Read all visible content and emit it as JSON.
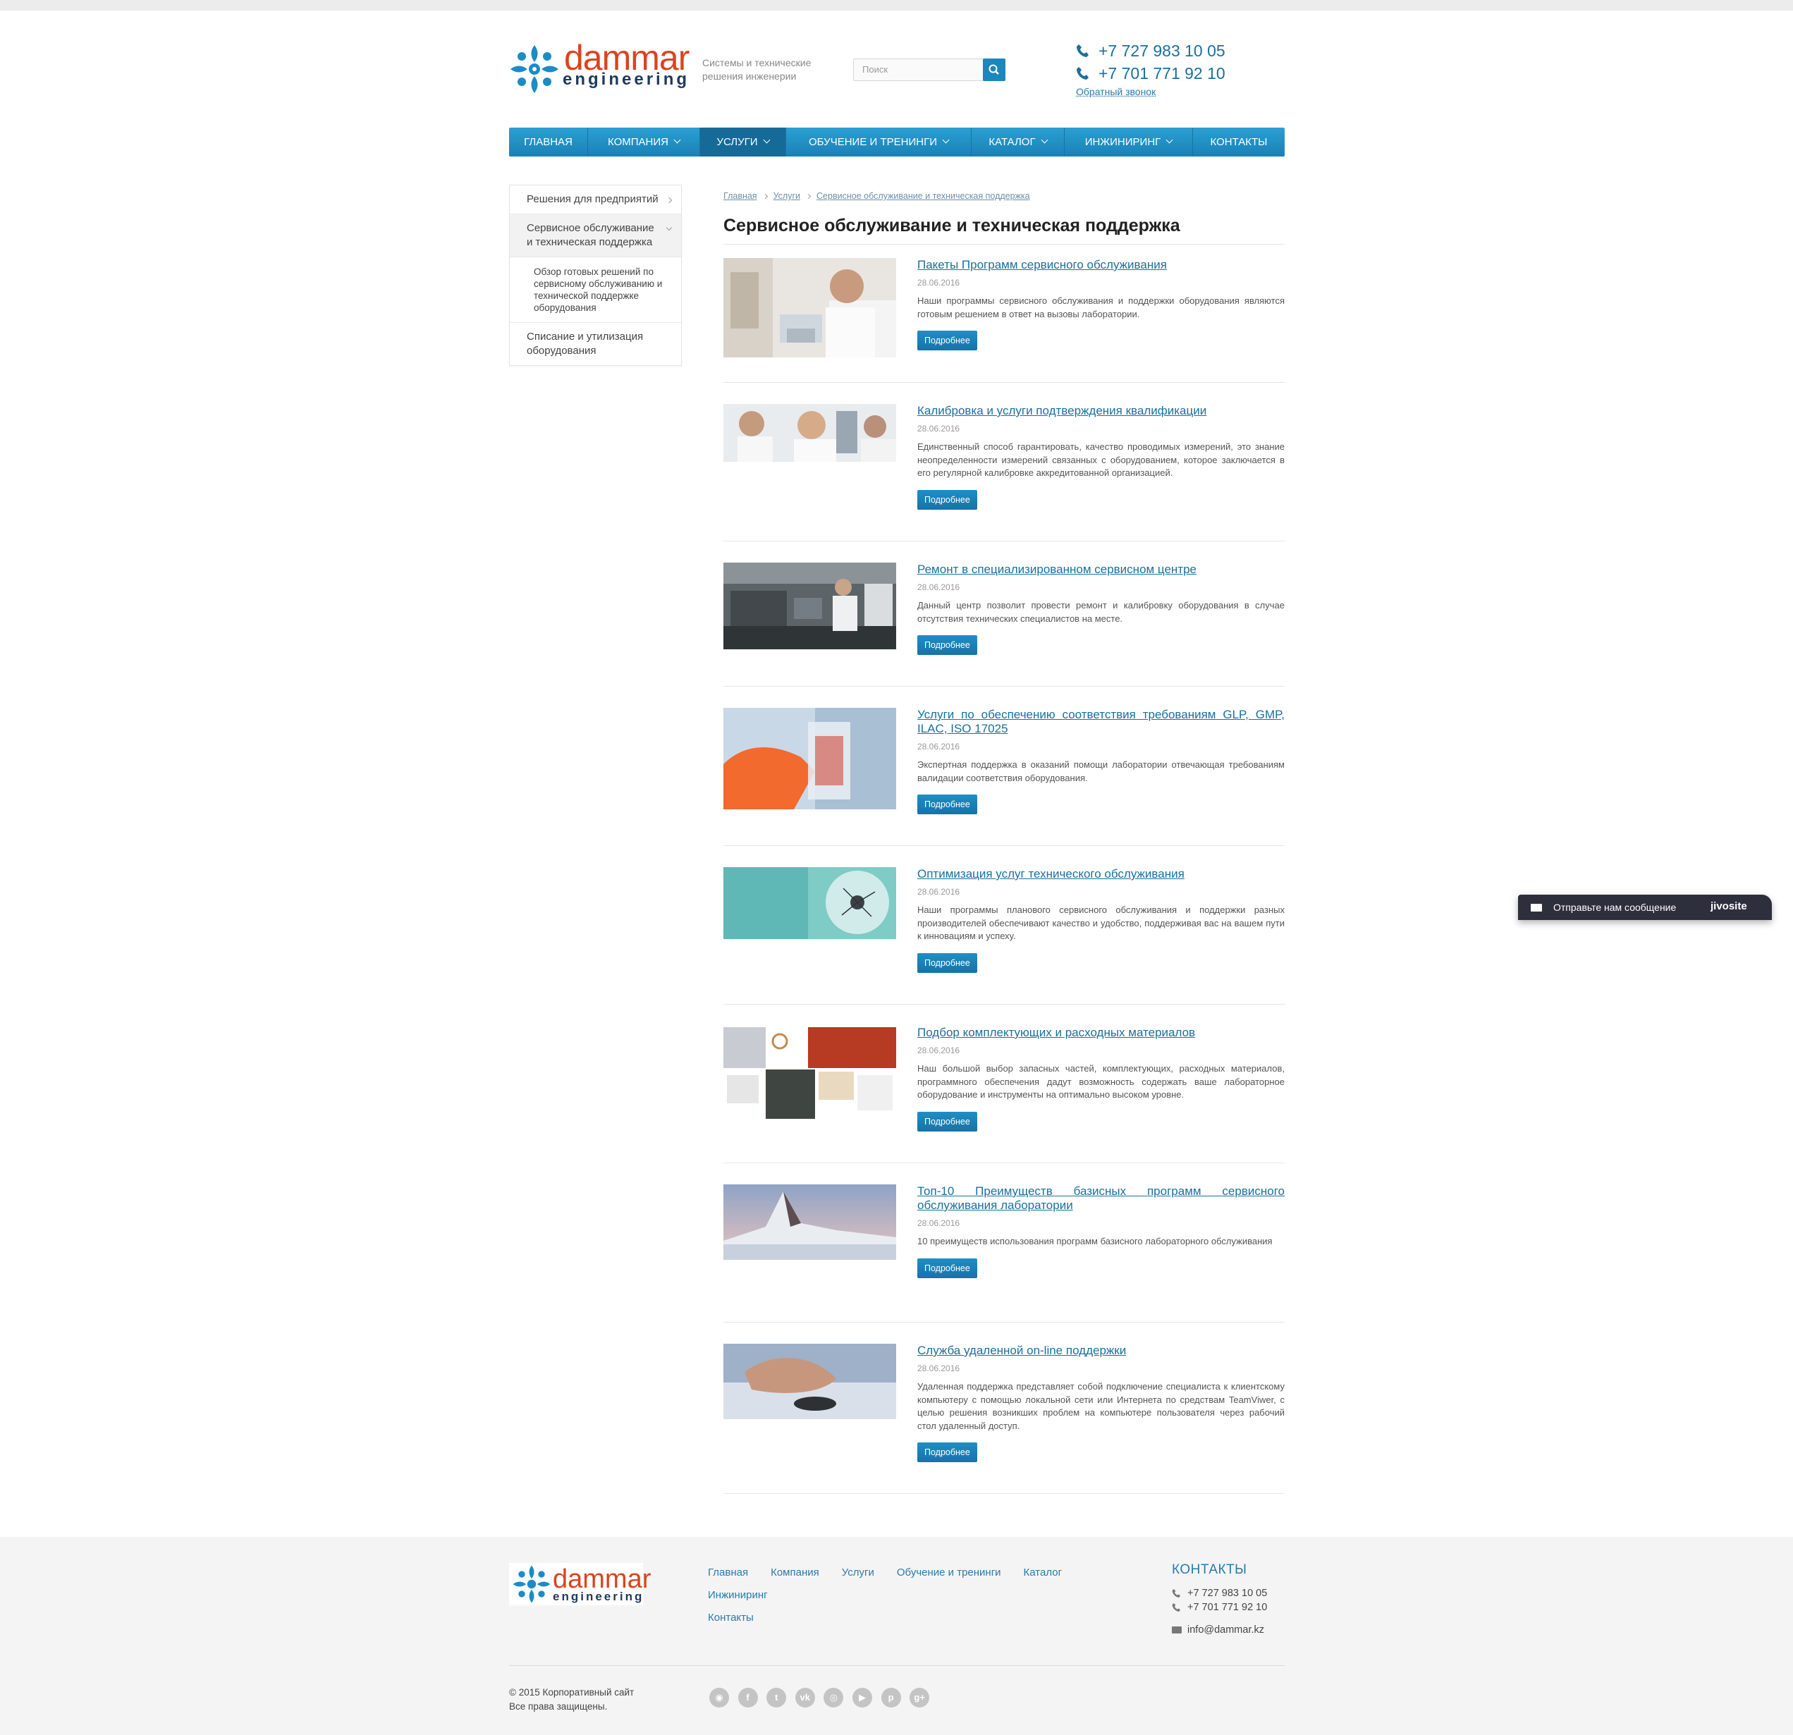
{
  "header": {
    "logo_word": "dammar",
    "logo_sub": "engineering",
    "slogan": "Системы и технические решения инженерии",
    "search_placeholder": "Поиск",
    "phone1": "+7 727 983 10 05",
    "phone2": "+7 701 771 92 10",
    "callback": "Обратный звонок"
  },
  "nav": [
    {
      "label": "ГЛАВНАЯ"
    },
    {
      "label": "КОМПАНИЯ"
    },
    {
      "label": "УСЛУГИ"
    },
    {
      "label": "ОБУЧЕНИЕ И ТРЕНИНГИ"
    },
    {
      "label": "КАТАЛОГ"
    },
    {
      "label": "ИНЖИНИРИНГ"
    },
    {
      "label": "КОНТАКТЫ"
    }
  ],
  "sidebar": {
    "items": [
      {
        "label": "Решения для предприятий"
      },
      {
        "label": "Сервисное обслуживание и техническая поддержка"
      },
      {
        "label": "Обзор готовых решений по сервисному обслуживанию и технической поддержке оборудования"
      },
      {
        "label": "Списание и утилизация оборудования"
      }
    ]
  },
  "breadcrumb": [
    "Главная",
    "Услуги",
    "Сервисное обслуживание и техническая поддержка"
  ],
  "page_title": "Сервисное обслуживание и техническая поддержка",
  "button_label": "Подробнее",
  "items": [
    {
      "title": "Пакеты Программ сервисного обслуживания",
      "date": "28.06.2016",
      "text": "Наши программы сервисного обслуживания и поддержки оборудования являются готовым решением в ответ на вызовы лаборатории."
    },
    {
      "title": "Калибровка и услуги подтверждения квалификации",
      "date": "28.06.2016",
      "text": "Единственный способ гарантировать, качество проводимых измерений, это знание неопределенности измерений связанных с оборудованием, которое заключается в его регулярной калибровке аккредитованной организацией."
    },
    {
      "title": "Ремонт в специализированном сервисном центре",
      "date": "28.06.2016",
      "text": "Данный центр позволит  провести ремонт и калибровку оборудования в случае отсутствия технических специалистов на месте."
    },
    {
      "title": "Услуги по обеспечению соответствия требованиям GLP, GMP, ILAC, ISO 17025",
      "date": "28.06.2016",
      "text": "Экспертная поддержка в оказаний помощи лаборатории отвечающая требованиям валидации соответствия оборудования."
    },
    {
      "title": "Оптимизация услуг технического обслуживания",
      "date": "28.06.2016",
      "text": "Наши программы планового сервисного обслуживания и поддержки разных производителей обеспечивают качество и удобство, поддерживая вас на вашем пути к инновациям и успеху."
    },
    {
      "title": "Подбор комплектующих и расходных материалов",
      "date": "28.06.2016",
      "text": "Наш большой выбор запасных частей, комплектующих, расходных материалов, программного обеспечения дадут возможность содержать ваше лабораторное оборудование и инструменты на оптимально высоком уровне."
    },
    {
      "title": "Топ-10 Преимуществ базисных программ сервисного обслуживания лаборатории",
      "date": "28.06.2016",
      "text": "10 преимуществ использования программ базисного лабораторного обслуживания"
    },
    {
      "title": "Служба удаленной on-line поддержки",
      "date": "28.06.2016",
      "text": "Удаленная поддержка представляет собой подключение специалиста к клиентскому компьютеру с помощью локальной сети или Интернета по средствам TeamViwer, с целью решения возникших проблем на компьютере пользователя через рабочий стол удаленный доступ."
    }
  ],
  "footer": {
    "links": [
      "Главная",
      "Компания",
      "Услуги",
      "Обучение и тренинги",
      "Каталог",
      "Инжиниринг",
      "Контакты"
    ],
    "contacts_title": "КОНТАКТЫ",
    "phone1": "+7 727 983 10 05",
    "phone2": "+7 701 771 92 10",
    "email": "info@dammar.kz",
    "copy1": "© 2015 Корпоративный сайт",
    "copy2": "Все права защищены.",
    "socials": [
      "rss-icon",
      "facebook-icon",
      "twitter-icon",
      "vk-icon",
      "instagram-icon",
      "youtube-icon",
      "pinterest-icon",
      "google-plus-icon"
    ]
  },
  "jivo": {
    "message": "Отправьте нам сообщение",
    "brand": "jivosite"
  },
  "colors": {
    "accent": "#1c87bc",
    "link": "#1a6f9e",
    "logo_red": "#d9441f"
  }
}
